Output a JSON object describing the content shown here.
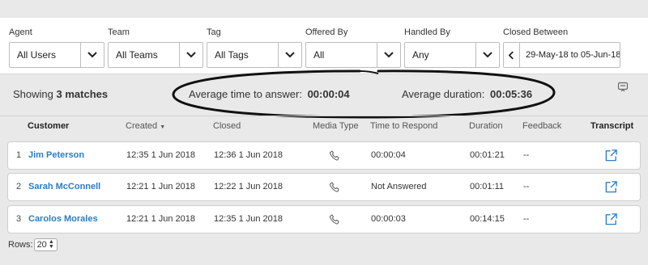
{
  "filters": {
    "agent": {
      "label": "Agent",
      "value": "All Users"
    },
    "team": {
      "label": "Team",
      "value": "All Teams"
    },
    "tag": {
      "label": "Tag",
      "value": "All Tags"
    },
    "offered_by": {
      "label": "Offered By",
      "value": "All"
    },
    "handled_by": {
      "label": "Handled By",
      "value": "Any"
    },
    "closed_between": {
      "label": "Closed Between",
      "value": "29-May-18 to 05-Jun-18"
    }
  },
  "summary": {
    "showing_prefix": "Showing",
    "showing_count": "3 matches",
    "avg_answer_label": "Average time to answer:",
    "avg_answer_value": "00:00:04",
    "avg_duration_label": "Average duration:",
    "avg_duration_value": "00:05:36"
  },
  "table": {
    "headers": {
      "customer": "Customer",
      "created": "Created",
      "closed": "Closed",
      "media_type": "Media Type",
      "time_to_respond": "Time to Respond",
      "duration": "Duration",
      "feedback": "Feedback",
      "transcript": "Transcript"
    },
    "rows": [
      {
        "index": "1",
        "customer": "Jim Peterson",
        "created": "12:35 1 Jun 2018",
        "closed": "12:36 1 Jun 2018",
        "time_to_respond": "00:00:04",
        "duration": "00:01:21",
        "feedback": "--"
      },
      {
        "index": "2",
        "customer": "Sarah McConnell",
        "created": "12:21 1 Jun 2018",
        "closed": "12:22 1 Jun 2018",
        "time_to_respond": "Not Answered",
        "duration": "00:01:11",
        "feedback": "--"
      },
      {
        "index": "3",
        "customer": "Carolos Morales",
        "created": "12:21 1 Jun 2018",
        "closed": "12:35 1 Jun 2018",
        "time_to_respond": "00:00:03",
        "duration": "00:14:15",
        "feedback": "--"
      }
    ]
  },
  "pagination": {
    "rows_label": "Rows:",
    "rows_value": "20"
  },
  "colors": {
    "link": "#2a7ec2",
    "background": "#e9e9e9",
    "panel": "#ffffff"
  },
  "icons": {
    "media": "phone-icon",
    "transcript": "external-link-icon",
    "export": "export-icon"
  }
}
